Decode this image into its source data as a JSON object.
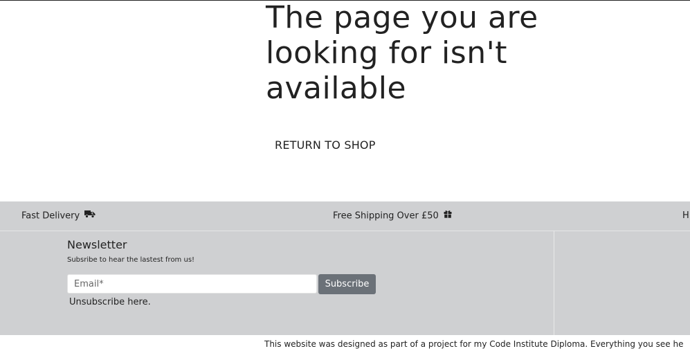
{
  "main": {
    "heading": "The page you are looking for isn't available",
    "return_link": "RETURN TO SHOP"
  },
  "perks": {
    "fast_delivery": "Fast Delivery",
    "fast_delivery_icon": "truck-icon",
    "free_shipping": "Free Shipping Over £50",
    "free_shipping_icon": "gift-icon",
    "third_partial": "H"
  },
  "newsletter": {
    "title": "Newsletter",
    "subtitle": "Subsribe to hear the lastest from us!",
    "email_placeholder": "Email*",
    "email_value": "",
    "subscribe_label": "Subscribe",
    "unsubscribe_label": "Unsubscribe here."
  },
  "disclaimer": "This website was designed as part of a project for my Code Institute Diploma. Everything you see he",
  "colors": {
    "footer_bg": "#cfd0d2",
    "button_bg": "#6b7178",
    "text": "#222222"
  }
}
